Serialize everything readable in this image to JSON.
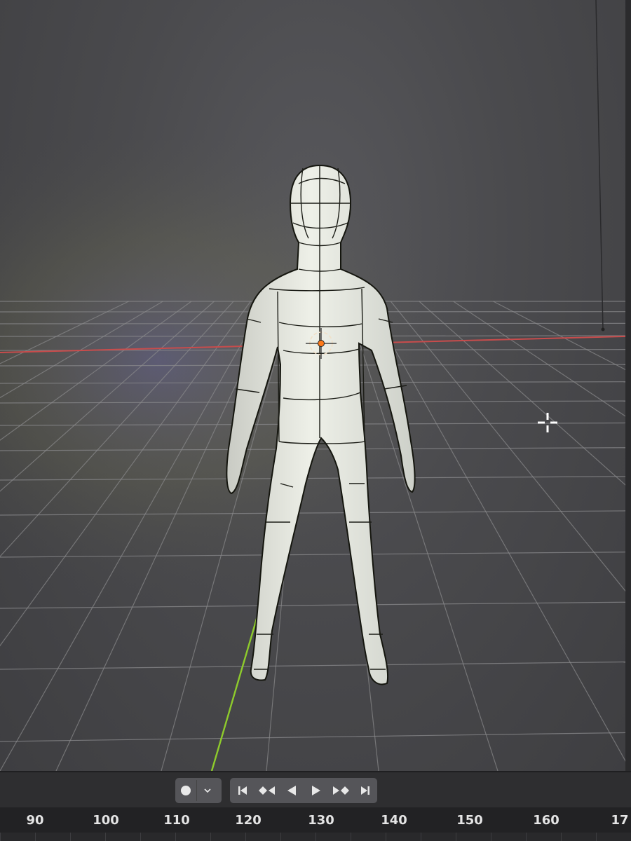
{
  "viewport": {
    "grid_color": "#8a8a8c",
    "x_axis_color": "#c84c4c",
    "y_axis_color": "#8ecb2c",
    "mesh_color": "#e4e6df",
    "origin_color": "#ff7a1a"
  },
  "playback": {
    "record_icon": "record-dot-icon",
    "dropdown_icon": "chevron-down-icon",
    "buttons": [
      {
        "name": "jump-to-start-button",
        "icon": "jump-start-icon"
      },
      {
        "name": "prev-keyframe-button",
        "icon": "prev-keyframe-icon"
      },
      {
        "name": "play-reverse-button",
        "icon": "play-reverse-icon"
      },
      {
        "name": "play-button",
        "icon": "play-icon"
      },
      {
        "name": "next-keyframe-button",
        "icon": "next-keyframe-icon"
      },
      {
        "name": "jump-to-end-button",
        "icon": "jump-end-icon"
      }
    ]
  },
  "timeline": {
    "ticks": [
      "90",
      "100",
      "110",
      "120",
      "130",
      "140",
      "150",
      "160",
      "17"
    ]
  }
}
